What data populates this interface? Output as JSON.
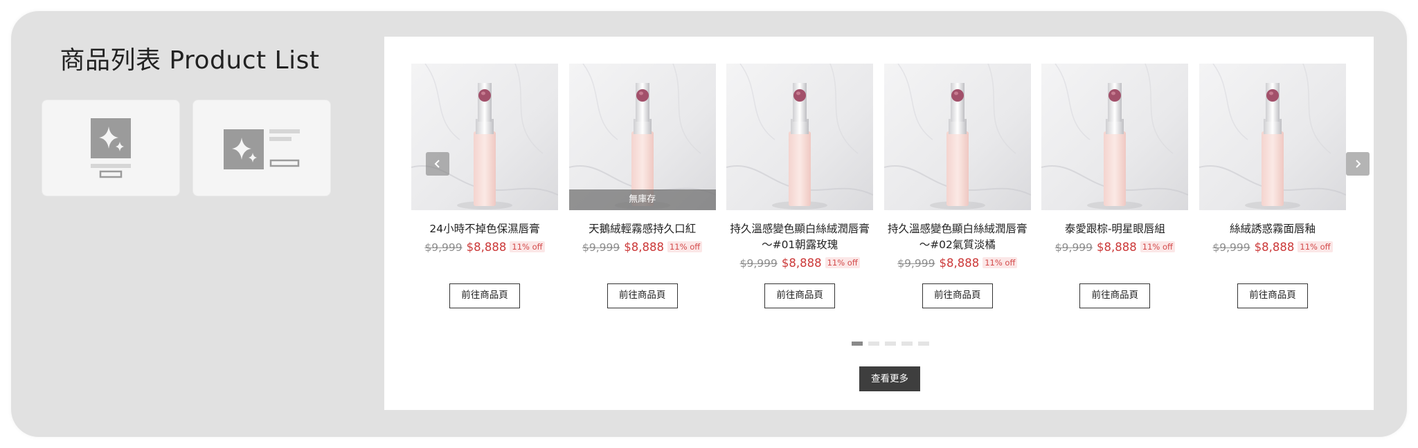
{
  "left": {
    "title": "商品列表 Product List",
    "layout_options": [
      "grid-layout",
      "list-layout"
    ]
  },
  "colors": {
    "frame_bg": "#e1e1e1",
    "panel_bg": "#ffffff",
    "sale_price": "#cc3a3a",
    "button_dark": "#3e3e3e"
  },
  "products": [
    {
      "name_lines": [
        "24小時不掉色保濕唇膏"
      ],
      "old_price": "$9,999",
      "new_price": "$8,888",
      "discount": "11% off",
      "out_of_stock": ""
    },
    {
      "name_lines": [
        "天鵝絨輕霧感持久口紅"
      ],
      "old_price": "$9,999",
      "new_price": "$8,888",
      "discount": "11% off",
      "out_of_stock": "無庫存"
    },
    {
      "name_lines": [
        "持久溫感變色顯白絲絨潤唇膏",
        "～#01朝露玫瑰"
      ],
      "old_price": "$9,999",
      "new_price": "$8,888",
      "discount": "11% off",
      "out_of_stock": ""
    },
    {
      "name_lines": [
        "持久溫感變色顯白絲絨潤唇膏",
        "～#02氣質淡橘"
      ],
      "old_price": "$9,999",
      "new_price": "$8,888",
      "discount": "11% off",
      "out_of_stock": ""
    },
    {
      "name_lines": [
        "泰愛跟棕-明星眼唇組"
      ],
      "old_price": "$9,999",
      "new_price": "$8,888",
      "discount": "11% off",
      "out_of_stock": ""
    },
    {
      "name_lines": [
        "絲絨誘惑霧面唇釉"
      ],
      "old_price": "$9,999",
      "new_price": "$8,888",
      "discount": "11% off",
      "out_of_stock": ""
    }
  ],
  "buttons": {
    "goto_label": "前往商品頁",
    "more_label": "查看更多"
  },
  "carousel": {
    "page_count": 5,
    "active_page": 1
  },
  "icons": {
    "prev": "chevron-left-icon",
    "next": "chevron-right-icon",
    "grid_layout": "grid-layout-icon",
    "list_layout": "list-layout-icon"
  }
}
